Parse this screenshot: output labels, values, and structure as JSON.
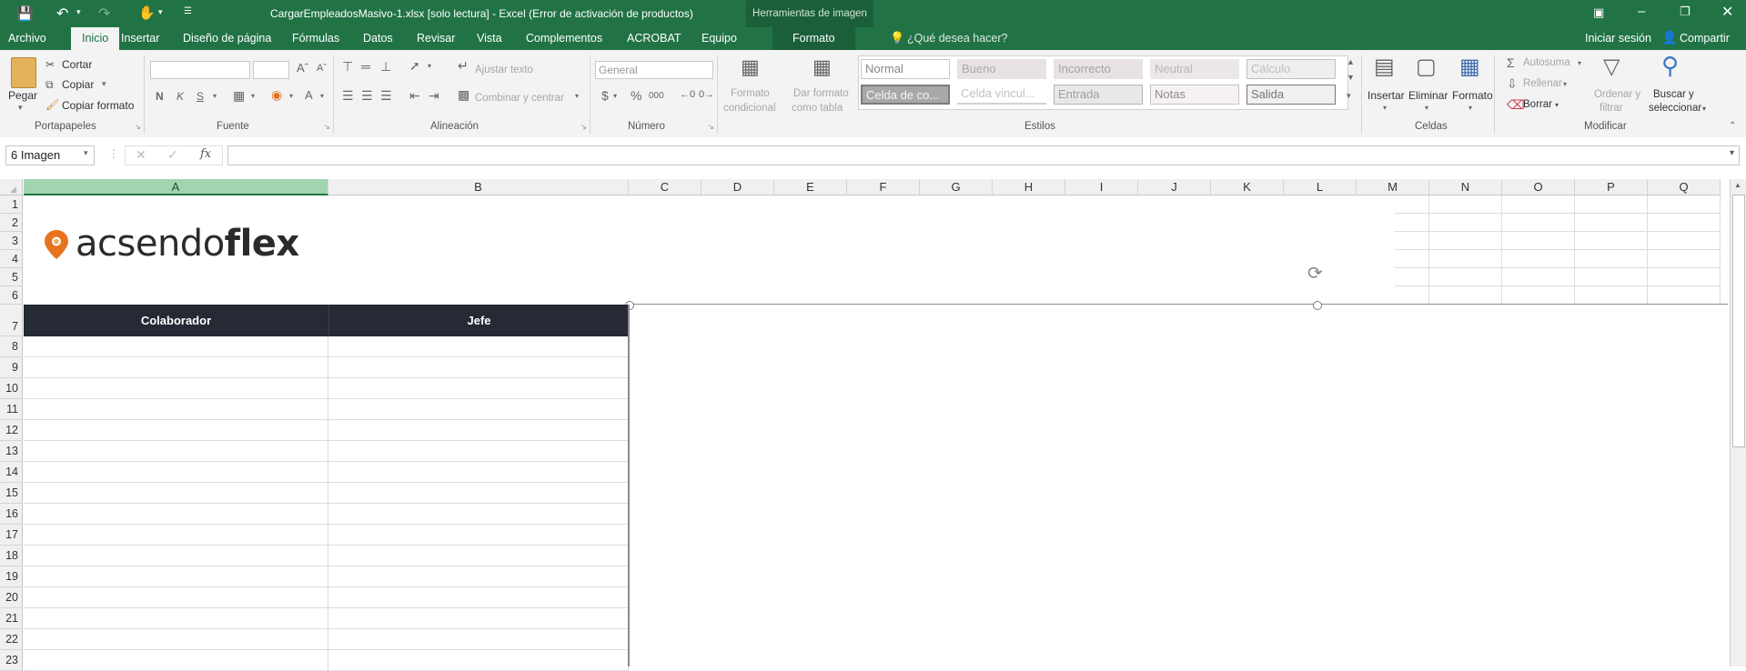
{
  "titlebar": {
    "title": "CargarEmpleadosMasivo-1.xlsx  [solo lectura] - Excel (Error de activación de productos)",
    "context_header": "Herramientas de imagen",
    "bg_color": "#217346"
  },
  "tabs": [
    {
      "label": "Archivo"
    },
    {
      "label": "Inicio"
    },
    {
      "label": "Insertar"
    },
    {
      "label": "Diseño de página"
    },
    {
      "label": "Fórmulas"
    },
    {
      "label": "Datos"
    },
    {
      "label": "Revisar"
    },
    {
      "label": "Vista"
    },
    {
      "label": "Complementos"
    },
    {
      "label": "ACROBAT"
    },
    {
      "label": "Equipo"
    },
    {
      "label": "Formato"
    }
  ],
  "tellme": "¿Qué desea hacer?",
  "signin": "Iniciar sesión",
  "share": "Compartir",
  "ribbon": {
    "clipboard": {
      "paste": "Pegar",
      "cut": "Cortar",
      "copy": "Copiar",
      "format_painter": "Copiar formato",
      "group": "Portapapeles"
    },
    "font": {
      "group": "Fuente"
    },
    "alignment": {
      "wrap": "Ajustar texto",
      "merge": "Combinar y centrar",
      "group": "Alineación"
    },
    "number": {
      "format": "General",
      "group": "Número"
    },
    "styles": {
      "cond_format_1": "Formato",
      "cond_format_2": "condicional",
      "as_table_1": "Dar formato",
      "as_table_2": "como tabla",
      "cells": [
        "Normal",
        "Bueno",
        "Incorrecto",
        "Neutral",
        "Cálculo",
        "Celda de co...",
        "Celda vincul...",
        "Entrada",
        "Notas",
        "Salida"
      ],
      "group": "Estilos"
    },
    "cells": {
      "insert": "Insertar",
      "delete": "Eliminar",
      "format": "Formato",
      "group": "Celdas"
    },
    "editing": {
      "autosum": "Autosuma",
      "fill": "Rellenar",
      "clear": "Borrar",
      "sort_1": "Ordenar y",
      "sort_2": "filtrar",
      "find_1": "Buscar y",
      "find_2": "seleccionar",
      "group": "Modificar"
    }
  },
  "formula_bar": {
    "name_box": "6 Imagen",
    "fx": "fx",
    "formula": ""
  },
  "sheet": {
    "columns": [
      "A",
      "B",
      "C",
      "D",
      "E",
      "F",
      "G",
      "H",
      "I",
      "J",
      "K",
      "L",
      "M",
      "N",
      "O",
      "P",
      "Q"
    ],
    "rows": [
      "1",
      "2",
      "3",
      "4",
      "5",
      "6",
      "7",
      "8",
      "9",
      "10",
      "11",
      "12",
      "13",
      "14",
      "15",
      "16",
      "17",
      "18",
      "19",
      "20",
      "21",
      "22",
      "23"
    ],
    "header_a": "Colaborador",
    "header_b": "Jefe",
    "logo_light": "acsendo",
    "logo_bold": "flex",
    "logo_color": "#e8731f"
  }
}
